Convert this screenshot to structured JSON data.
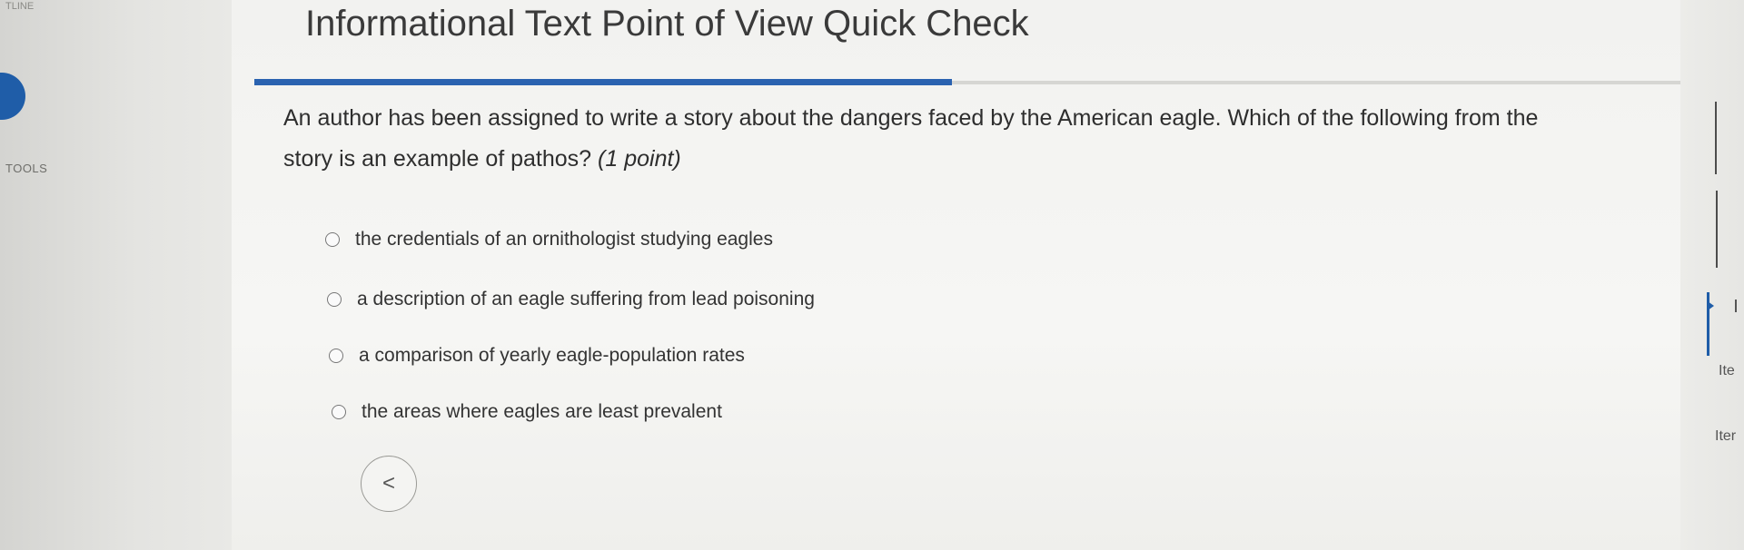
{
  "sidebar": {
    "top_label": "TLINE",
    "tools_label": "TOOLS"
  },
  "quiz": {
    "title": "Informational Text Point of View Quick Check",
    "progress": 0.48,
    "progress_color": "#2a62b0",
    "question_text": "An author has been assigned to write a story about the dangers faced by the American eagle. Which of the following from the story is an example of pathos?",
    "points_label": "(1 point)",
    "options": [
      {
        "label": "the credentials of an ornithologist studying eagles"
      },
      {
        "label": "a description of an eagle suffering from lead poisoning"
      },
      {
        "label": "a comparison of yearly eagle-population rates"
      },
      {
        "label": "the areas where eagles are least prevalent"
      }
    ]
  },
  "navigation": {
    "prev_icon": "chevron-left-icon",
    "prev_glyph": "<"
  },
  "item_panel": {
    "labels": [
      "Ite",
      "Iter"
    ]
  },
  "colors": {
    "accent": "#1f5da8"
  }
}
